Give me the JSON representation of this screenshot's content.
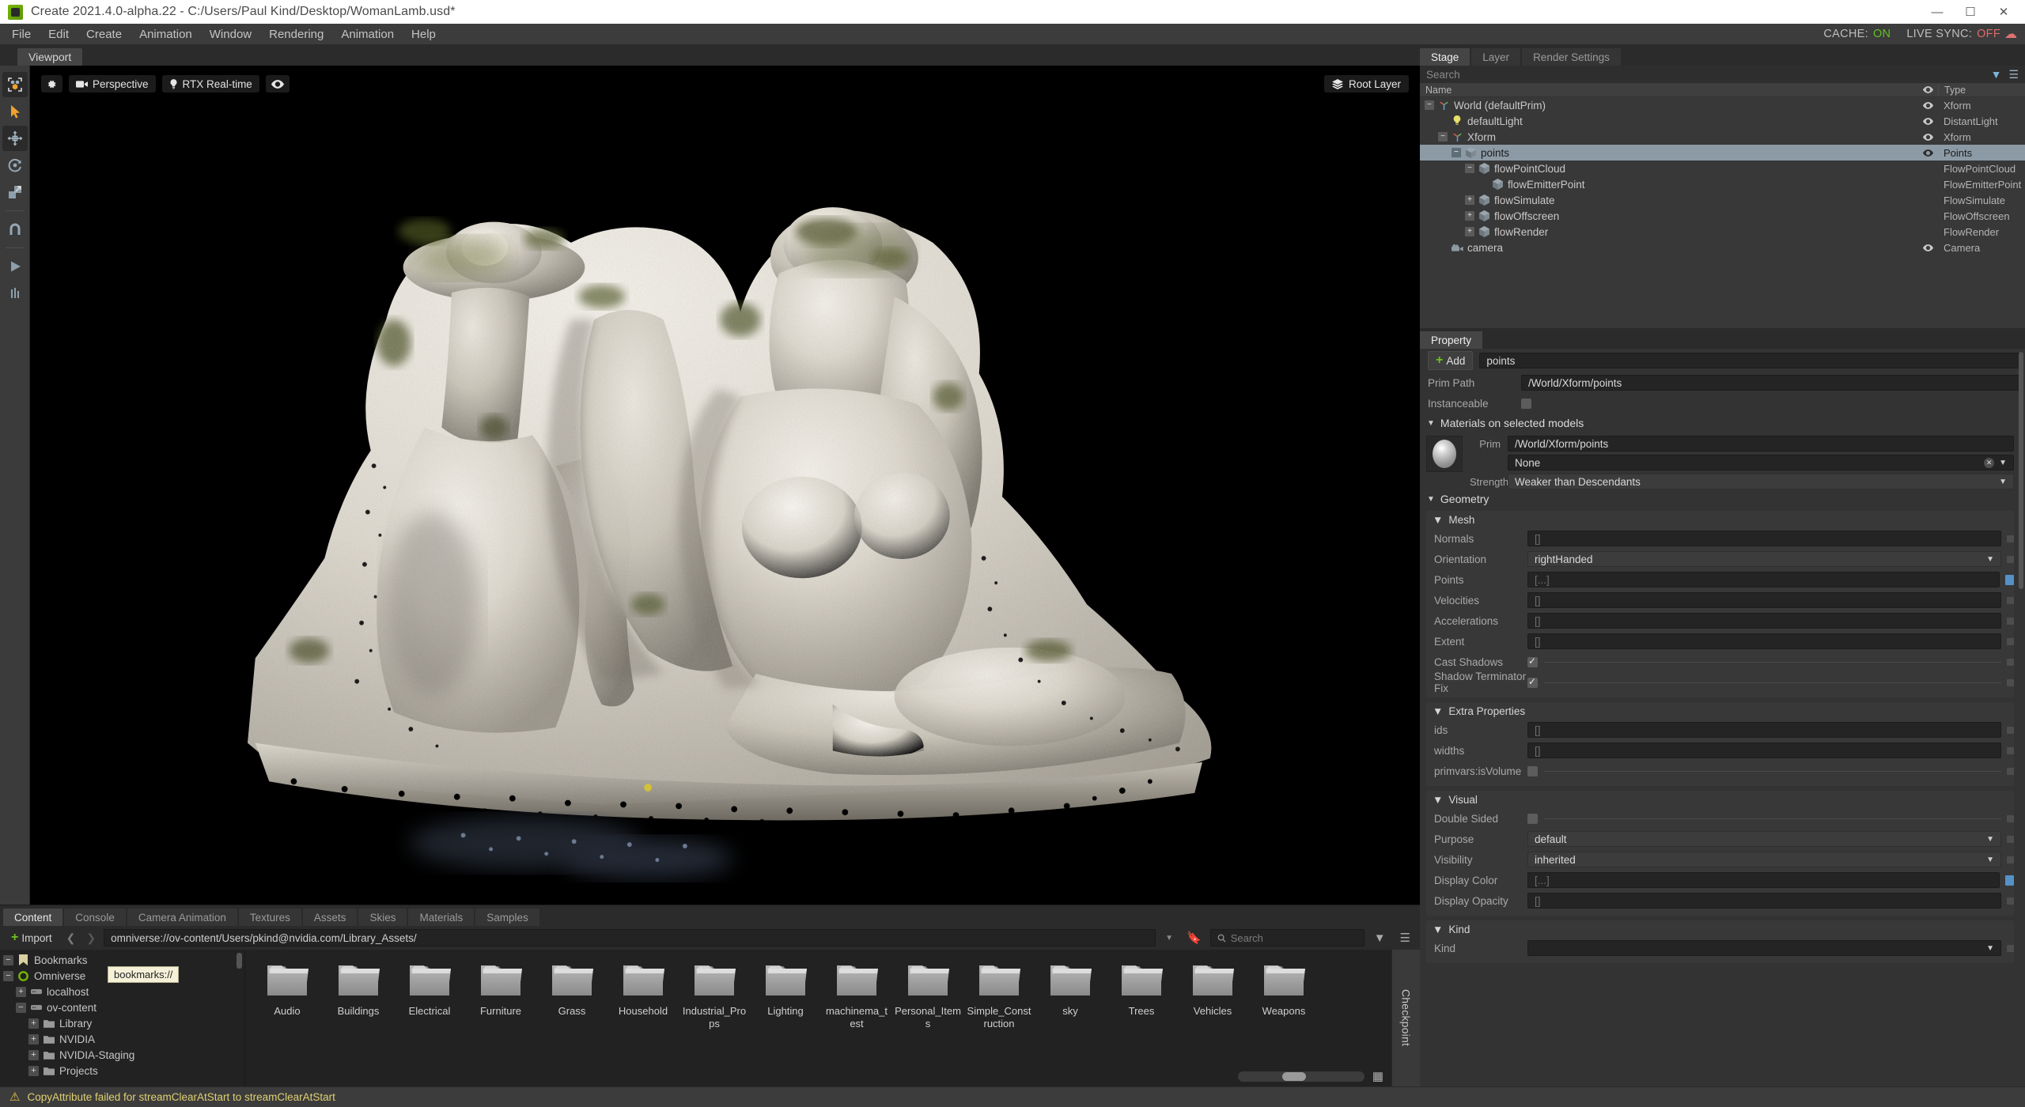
{
  "window": {
    "title": "Create 2021.4.0-alpha.22 - C:/Users/Paul Kind/Desktop/WomanLamb.usd*",
    "minimize": "—",
    "maximize": "☐",
    "close": "✕"
  },
  "menubar": {
    "items": [
      "File",
      "Edit",
      "Create",
      "Animation",
      "Window",
      "Rendering",
      "Animation",
      "Help"
    ],
    "cache_label": "CACHE:",
    "cache_value": "ON",
    "livesync_label": "LIVE SYNC:",
    "livesync_value": "OFF"
  },
  "viewport": {
    "tab": "Viewport",
    "camera": "Perspective",
    "renderer": "RTX Real-time",
    "root_layer": "Root Layer",
    "gear_icon": "gear-icon",
    "camera_icon": "camera-icon",
    "bulb_icon": "lightbulb-icon",
    "eye_icon": "eye-icon",
    "layers_icon": "layers-icon"
  },
  "toolrail": {
    "items": [
      {
        "name": "selection-mode-icon",
        "glyph": "select"
      },
      {
        "name": "select-arrow-icon",
        "glyph": "arrow"
      },
      {
        "name": "move-tool-icon",
        "glyph": "move"
      },
      {
        "name": "rotate-tool-icon",
        "glyph": "rotate"
      },
      {
        "name": "scale-tool-icon",
        "glyph": "scale"
      },
      {
        "name": "snap-tool-icon",
        "glyph": "snap"
      },
      {
        "name": "play-tool-icon",
        "glyph": "play"
      },
      {
        "name": "physics-tool-icon",
        "glyph": "physics"
      }
    ]
  },
  "stage": {
    "tabs": [
      {
        "label": "Stage",
        "active": true
      },
      {
        "label": "Layer",
        "active": false
      },
      {
        "label": "Render Settings",
        "active": false
      }
    ],
    "search_placeholder": "Search",
    "columns": {
      "name": "Name",
      "type": "Type"
    },
    "rows": [
      {
        "label": "World (defaultPrim)",
        "type": "Xform",
        "depth": 0,
        "expander": "−",
        "icon": "xform-icon",
        "eye": true,
        "selected": false
      },
      {
        "label": "defaultLight",
        "type": "DistantLight",
        "depth": 1,
        "expander": "",
        "icon": "light-icon",
        "eye": true,
        "selected": false
      },
      {
        "label": "Xform",
        "type": "Xform",
        "depth": 1,
        "expander": "−",
        "icon": "xform-icon",
        "eye": true,
        "selected": false
      },
      {
        "label": "points",
        "type": "Points",
        "depth": 2,
        "expander": "−",
        "icon": "mesh-icon",
        "eye": true,
        "selected": true
      },
      {
        "label": "flowPointCloud",
        "type": "FlowPointCloud",
        "depth": 3,
        "expander": "−",
        "icon": "mesh-icon",
        "eye": false,
        "selected": false
      },
      {
        "label": "flowEmitterPoint",
        "type": "FlowEmitterPoint",
        "depth": 4,
        "expander": "",
        "icon": "mesh-icon",
        "eye": false,
        "selected": false
      },
      {
        "label": "flowSimulate",
        "type": "FlowSimulate",
        "depth": 3,
        "expander": "+",
        "icon": "mesh-icon",
        "eye": false,
        "selected": false
      },
      {
        "label": "flowOffscreen",
        "type": "FlowOffscreen",
        "depth": 3,
        "expander": "+",
        "icon": "mesh-icon",
        "eye": false,
        "selected": false
      },
      {
        "label": "flowRender",
        "type": "FlowRender",
        "depth": 3,
        "expander": "+",
        "icon": "mesh-icon",
        "eye": false,
        "selected": false
      },
      {
        "label": "camera",
        "type": "Camera",
        "depth": 1,
        "expander": "",
        "icon": "camera-prim-icon",
        "eye": true,
        "selected": false
      }
    ]
  },
  "property": {
    "tab": "Property",
    "add_button": "Add",
    "name_value": "points",
    "prim_path_label": "Prim Path",
    "prim_path_value": "/World/Xform/points",
    "instanceable_label": "Instanceable",
    "materials": {
      "title": "Materials on selected models",
      "prim_label": "Prim",
      "prim_value": "/World/Xform/points",
      "material_value": "None",
      "strength_label": "Strength",
      "strength_value": "Weaker than Descendants"
    },
    "geometry": {
      "title": "Geometry",
      "mesh_title": "Mesh",
      "rows": [
        {
          "label": "Normals",
          "value": "[]",
          "kind": "field",
          "badge": "gray"
        },
        {
          "label": "Orientation",
          "value": "rightHanded",
          "kind": "combo",
          "badge": "gray"
        },
        {
          "label": "Points",
          "value": "[...]",
          "kind": "field-dim",
          "badge": "blue"
        },
        {
          "label": "Velocities",
          "value": "[]",
          "kind": "field",
          "badge": "gray"
        },
        {
          "label": "Accelerations",
          "value": "[]",
          "kind": "field",
          "badge": "gray"
        },
        {
          "label": "Extent",
          "value": "[]",
          "kind": "field",
          "badge": "gray"
        },
        {
          "label": "Cast Shadows",
          "value": "",
          "kind": "checkbox-on",
          "badge": "gray"
        },
        {
          "label": "Shadow Terminator Fix",
          "value": "",
          "kind": "checkbox-on",
          "badge": "gray"
        }
      ]
    },
    "extra": {
      "title": "Extra Properties",
      "rows": [
        {
          "label": "ids",
          "value": "[]",
          "kind": "field",
          "badge": "gray"
        },
        {
          "label": "widths",
          "value": "[]",
          "kind": "field",
          "badge": "gray"
        },
        {
          "label": "primvars:isVolume",
          "value": "",
          "kind": "checkbox-off",
          "badge": "gray"
        }
      ]
    },
    "visual": {
      "title": "Visual",
      "rows": [
        {
          "label": "Double Sided",
          "value": "",
          "kind": "checkbox-off",
          "badge": "gray"
        },
        {
          "label": "Purpose",
          "value": "default",
          "kind": "combo",
          "badge": "gray"
        },
        {
          "label": "Visibility",
          "value": "inherited",
          "kind": "combo",
          "badge": "gray"
        },
        {
          "label": "Display Color",
          "value": "[...]",
          "kind": "field-dim",
          "badge": "blue"
        },
        {
          "label": "Display Opacity",
          "value": "[]",
          "kind": "field",
          "badge": "gray"
        }
      ]
    },
    "kind": {
      "title": "Kind",
      "label": "Kind",
      "value": ""
    }
  },
  "content": {
    "tabs": [
      {
        "label": "Content",
        "active": true
      },
      {
        "label": "Console",
        "active": false
      },
      {
        "label": "Camera Animation",
        "active": false
      },
      {
        "label": "Textures",
        "active": false
      },
      {
        "label": "Assets",
        "active": false
      },
      {
        "label": "Skies",
        "active": false
      },
      {
        "label": "Materials",
        "active": false
      },
      {
        "label": "Samples",
        "active": false
      }
    ],
    "import_label": "Import",
    "path": "omniverse://ov-content/Users/pkind@nvidia.com/Library_Assets/",
    "search_placeholder": "Search",
    "tooltip": "bookmarks://",
    "tree": [
      {
        "label": "Bookmarks",
        "depth": 0,
        "expander": "−",
        "icon": "bookmark-icon"
      },
      {
        "label": "Omniverse",
        "depth": 0,
        "expander": "−",
        "icon": "omniverse-icon"
      },
      {
        "label": "localhost",
        "depth": 1,
        "expander": "+",
        "icon": "server-icon"
      },
      {
        "label": "ov-content",
        "depth": 1,
        "expander": "−",
        "icon": "server-icon"
      },
      {
        "label": "Library",
        "depth": 2,
        "expander": "+",
        "icon": "folder-icon"
      },
      {
        "label": "NVIDIA",
        "depth": 2,
        "expander": "+",
        "icon": "folder-icon"
      },
      {
        "label": "NVIDIA-Staging",
        "depth": 2,
        "expander": "+",
        "icon": "folder-icon"
      },
      {
        "label": "Projects",
        "depth": 2,
        "expander": "+",
        "icon": "folder-icon"
      }
    ],
    "folders": [
      "Audio",
      "Buildings",
      "Electrical",
      "Furniture",
      "Grass",
      "Household",
      "Industrial_Props",
      "Lighting",
      "machinema_test",
      "Personal_Items",
      "Simple_Construction",
      "sky",
      "Trees",
      "Vehicles",
      "Weapons"
    ],
    "checkpoint_label": "Checkpoint"
  },
  "statusbar": {
    "warning_icon": "warning-icon",
    "message": "CopyAttribute failed for streamClearAtStart to streamClearAtStart"
  },
  "colors": {
    "accent_green": "#76b900",
    "selection": "#8c9aa5",
    "warning": "#e0d070",
    "blue_badge": "#5591c7"
  }
}
